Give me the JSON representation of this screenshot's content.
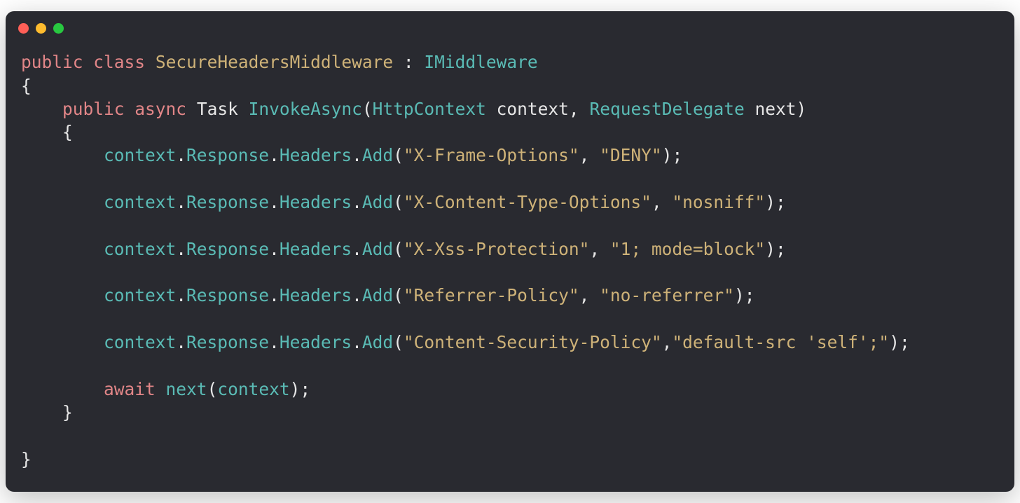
{
  "colors": {
    "background": "#292A30",
    "dots": {
      "red": "#FF5F57",
      "yellow": "#FEBC2E",
      "green": "#28C840"
    }
  },
  "code": {
    "kw_public1": "public",
    "kw_class": "class",
    "class_name": "SecureHeadersMiddleware",
    "colon": " : ",
    "interface": "IMiddleware",
    "brace_open1": "{",
    "kw_public2": "public",
    "kw_async": "async",
    "type_task": "Task",
    "method_name": "InvokeAsync",
    "paren_open1": "(",
    "type_http": "HttpContext",
    "param_ctx": " context",
    "comma1": ", ",
    "type_reqdel": "RequestDelegate",
    "param_next": " next",
    "paren_close1": ")",
    "brace_open2": "{",
    "calls": [
      {
        "prefix": "context",
        "dot1": ".",
        "resp": "Response",
        "dot2": ".",
        "hdrs": "Headers",
        "dot3": ".",
        "add": "Add",
        "po": "(",
        "arg1": "\"X-Frame-Options\"",
        "sep": ", ",
        "arg2": "\"DENY\"",
        "pc": ")",
        "semi": ";"
      },
      {
        "prefix": "context",
        "dot1": ".",
        "resp": "Response",
        "dot2": ".",
        "hdrs": "Headers",
        "dot3": ".",
        "add": "Add",
        "po": "(",
        "arg1": "\"X-Content-Type-Options\"",
        "sep": ", ",
        "arg2": "\"nosniff\"",
        "pc": ")",
        "semi": ";"
      },
      {
        "prefix": "context",
        "dot1": ".",
        "resp": "Response",
        "dot2": ".",
        "hdrs": "Headers",
        "dot3": ".",
        "add": "Add",
        "po": "(",
        "arg1": "\"X-Xss-Protection\"",
        "sep": ", ",
        "arg2": "\"1; mode=block\"",
        "pc": ")",
        "semi": ";"
      },
      {
        "prefix": "context",
        "dot1": ".",
        "resp": "Response",
        "dot2": ".",
        "hdrs": "Headers",
        "dot3": ".",
        "add": "Add",
        "po": "(",
        "arg1": "\"Referrer-Policy\"",
        "sep": ", ",
        "arg2": "\"no-referrer\"",
        "pc": ")",
        "semi": ";"
      },
      {
        "prefix": "context",
        "dot1": ".",
        "resp": "Response",
        "dot2": ".",
        "hdrs": "Headers",
        "dot3": ".",
        "add": "Add",
        "po": "(",
        "arg1": "\"Content-Security-Policy\"",
        "sep": ",",
        "arg2": "\"default-src 'self';\"",
        "pc": ")",
        "semi": ";"
      }
    ],
    "kw_await": "await",
    "call_next": "next",
    "paren_open2": "(",
    "arg_ctx": "context",
    "paren_close2": ")",
    "semi_last": ";",
    "brace_close2": "}",
    "brace_close1": "}"
  }
}
